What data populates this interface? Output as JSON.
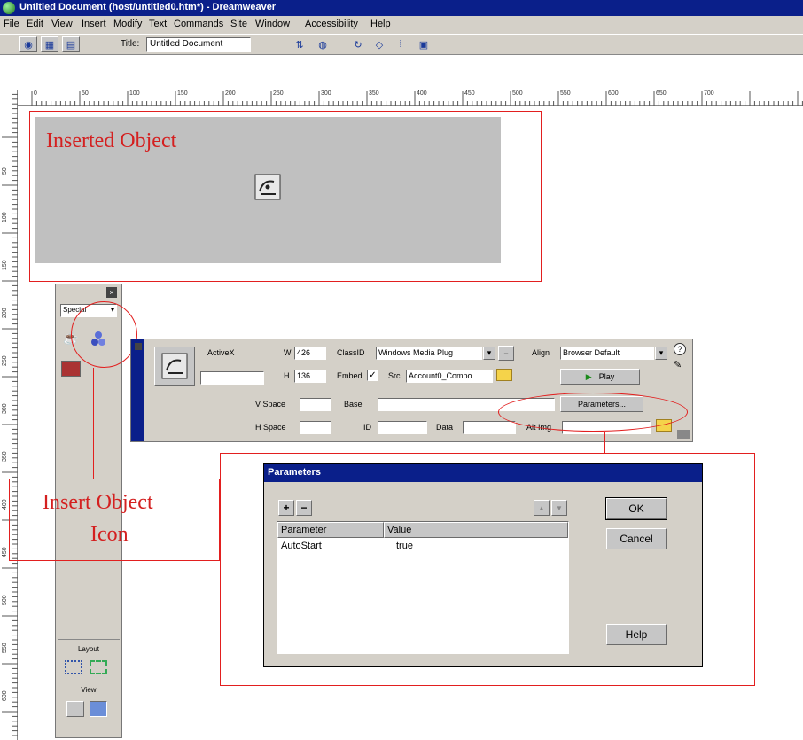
{
  "window": {
    "title": "Untitled Document (host/untitled0.htm*) - Dreamweaver"
  },
  "menu": [
    "File",
    "Edit",
    "View",
    "Insert",
    "Modify",
    "Text",
    "Commands",
    "Site",
    "Window",
    "Accessibility",
    "Help"
  ],
  "toolbar": {
    "title_label": "Title:",
    "title_value": "Untitled Document"
  },
  "ruler": {
    "h_labels": [
      "0",
      "50",
      "100",
      "150",
      "200",
      "250",
      "300",
      "350",
      "400",
      "450",
      "500",
      "550",
      "600",
      "650",
      "700"
    ],
    "v_labels": [
      "50",
      "100",
      "150",
      "200",
      "250",
      "300",
      "350",
      "400",
      "450",
      "500",
      "550",
      "600",
      "650",
      "700"
    ]
  },
  "callouts": {
    "inserted_object": "Inserted Object",
    "insert_icon_line1": "Insert Object",
    "insert_icon_line2": "Icon"
  },
  "objects_panel": {
    "category": "Special",
    "layout_label": "Layout",
    "view_label": "View"
  },
  "inspector": {
    "name_label": "ActiveX",
    "w_label": "W",
    "w_value": "426",
    "h_label": "H",
    "h_value": "136",
    "classid_label": "ClassID",
    "classid_value": "Windows Media Plug",
    "embed_label": "Embed",
    "src_label": "Src",
    "src_value": "Account0_Compo",
    "align_label": "Align",
    "align_value": "Browser Default",
    "play_label": "Play",
    "vspace_label": "V Space",
    "hspace_label": "H Space",
    "base_label": "Base",
    "id_label": "ID",
    "data_label": "Data",
    "altimg_label": "Alt Img",
    "parameters_button": "Parameters..."
  },
  "dialog": {
    "title": "Parameters",
    "add": "+",
    "remove": "−",
    "up": "▲",
    "down": "▼",
    "col_param": "Parameter",
    "col_value": "Value",
    "rows": [
      {
        "param": "AutoStart",
        "value": "true"
      }
    ],
    "ok": "OK",
    "cancel": "Cancel",
    "help": "Help"
  }
}
